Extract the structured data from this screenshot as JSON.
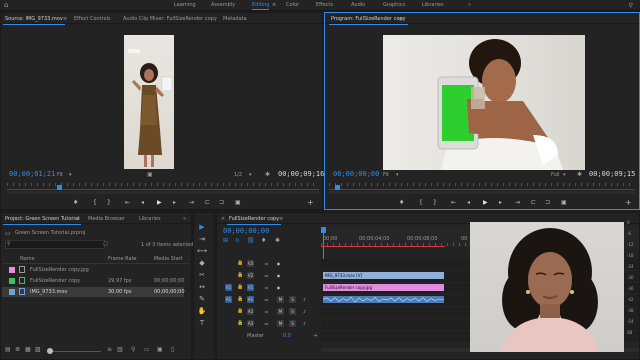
{
  "workspace_bar": {
    "tabs": [
      "Learning",
      "Assembly",
      "Editing",
      "Color",
      "Effects",
      "Audio",
      "Graphics",
      "Libraries"
    ],
    "active": "Editing",
    "menu_glyph": "≡",
    "overflow_glyph": "»"
  },
  "source_panel": {
    "tabs": [
      "Source: IMG_9733.mov",
      "Effect Controls",
      "Audio Clip Mixer: FullSizeRender copy",
      "Metadata"
    ],
    "menu_glyph": "≡",
    "timecode": "00;00;01;21",
    "fit": "Fit",
    "ratio": "1/2",
    "duration": "00;00;09;16",
    "video_caption": "IMG_9733.mov",
    "transport": [
      "♦",
      "{",
      "}",
      "⇤",
      "◂",
      "▶",
      "▸",
      "⇥",
      "⊏",
      "⊐",
      "▣",
      "+"
    ]
  },
  "program_panel": {
    "title": "Program: FullSizeRender copy",
    "menu_glyph": "≡",
    "timecode": "00;00;00;00",
    "fit": "Fit",
    "quality": "Full",
    "duration": "00;00;09;15",
    "transport": [
      "♦",
      "{",
      "}",
      "⇤",
      "◂",
      "▶",
      "▸",
      "⇥",
      "⊏",
      "⊐",
      "▣",
      "+"
    ]
  },
  "project_panel": {
    "tabs": [
      "Project: Green Screen Tutorial",
      "Media Browser",
      "Libraries"
    ],
    "overflow_glyph": "»",
    "menu_glyph": "≡",
    "project_file": "Green Screen Tutorial.prproj",
    "selection_info": "1 of 3 items selected",
    "columns": [
      "Name",
      "Frame Rate",
      "Media Start"
    ],
    "items": [
      {
        "name": "FullSizeRender copy.jpg",
        "frame_rate": "",
        "media_start": "",
        "color": "#e88ee0"
      },
      {
        "name": "FullSizeRender copy",
        "frame_rate": "29.97 fps",
        "media_start": "00;00;00;00",
        "color": "#3fbf63"
      },
      {
        "name": "IMG_9733.mov",
        "frame_rate": "30.00 fps",
        "media_start": "00;00;00;00",
        "color": "#6fa3d8"
      }
    ]
  },
  "timeline_panel": {
    "tab": "FullSizeRender copy",
    "menu_glyph": "≡",
    "timecode": "00;00;00;00",
    "ruler": [
      "00;00",
      "00;00;04;00",
      "00;00;08;00",
      "00"
    ],
    "tracks": [
      {
        "id": "V3",
        "src": ""
      },
      {
        "id": "V2",
        "src": ""
      },
      {
        "id": "V1",
        "src": "V1"
      },
      {
        "id": "A1",
        "src": "A1"
      },
      {
        "id": "A2",
        "src": ""
      },
      {
        "id": "A3",
        "src": ""
      }
    ],
    "master_label": "Master",
    "master_value": "0.0",
    "clips": {
      "v2": "IMG_9733.mov [V]",
      "v1": "FullSizeRender copy.jpg"
    }
  },
  "audio_meter": {
    "scale": [
      "0",
      "-6",
      "-12",
      "-18",
      "-24",
      "-30",
      "-36",
      "-42",
      "-48",
      "-54",
      "dB"
    ]
  },
  "icons": {
    "tools": [
      "▶",
      "⇥",
      "⟷",
      "◆",
      "✂",
      "↔",
      "✎",
      "✋",
      "T"
    ]
  }
}
